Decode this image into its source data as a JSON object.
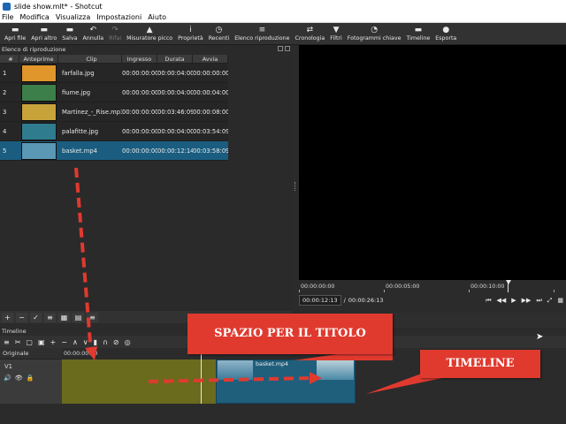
{
  "window": {
    "title": "slide show.mlt* - Shotcut"
  },
  "menu": [
    "File",
    "Modifica",
    "Visualizza",
    "Impostazioni",
    "Aiuto"
  ],
  "toolbar": [
    {
      "label": "Apri file",
      "icon": "folder-open-icon",
      "glyph": "▬"
    },
    {
      "label": "Apri altro",
      "icon": "open-other-icon",
      "glyph": "▬"
    },
    {
      "label": "Salva",
      "icon": "save-icon",
      "glyph": "▬"
    },
    {
      "label": "Annulla",
      "icon": "undo-icon",
      "glyph": "↶"
    },
    {
      "label": "Rifai",
      "icon": "redo-icon",
      "glyph": "↷"
    },
    {
      "label": "Misuratore picco",
      "icon": "peak-meter-icon",
      "glyph": "▲"
    },
    {
      "label": "Proprietà",
      "icon": "info-icon",
      "glyph": "i"
    },
    {
      "label": "Recenti",
      "icon": "clock-icon",
      "glyph": "◷"
    },
    {
      "label": "Elenco riproduzione",
      "icon": "playlist-icon",
      "glyph": "≡"
    },
    {
      "label": "Cronologia",
      "icon": "history-icon",
      "glyph": "⇄"
    },
    {
      "label": "Filtri",
      "icon": "filter-icon",
      "glyph": "▼"
    },
    {
      "label": "Fotogrammi chiave",
      "icon": "keyframes-icon",
      "glyph": "◔"
    },
    {
      "label": "Timeline",
      "icon": "timeline-icon",
      "glyph": "▬"
    },
    {
      "label": "Esporta",
      "icon": "export-icon",
      "glyph": "●"
    }
  ],
  "playlist": {
    "title": "Elenco di riproduzione",
    "columns": [
      "#",
      "Anteprime",
      "Clip",
      "Ingresso",
      "Durata",
      "Avvia"
    ],
    "rows": [
      {
        "num": "1",
        "clip": "farfalla.jpg",
        "in": "00:00:00:00",
        "dur": "00:00:04:00",
        "start": "00:00:00:00",
        "thumb": "#e0962a"
      },
      {
        "num": "2",
        "clip": "fiume.jpg",
        "in": "00:00:00:00",
        "dur": "00:00:04:00",
        "start": "00:00:04:00",
        "thumb": "#3d7f4a"
      },
      {
        "num": "3",
        "clip": "Martinez_-_Rise.mp3",
        "in": "00:00:00:00",
        "dur": "00:03:46:09",
        "start": "00:00:08:00",
        "thumb": "#c8a23b"
      },
      {
        "num": "4",
        "clip": "palafitte.jpg",
        "in": "00:00:00:00",
        "dur": "00:00:04:00",
        "start": "00:03:54:09",
        "thumb": "#2f7c8f"
      },
      {
        "num": "5",
        "clip": "basket.mp4",
        "in": "00:00:00:00",
        "dur": "00:00:12:14",
        "start": "00:03:58:09",
        "thumb": "#5a98b5",
        "selected": true
      }
    ],
    "footer_buttons": [
      {
        "name": "add-icon",
        "glyph": "+"
      },
      {
        "name": "remove-icon",
        "glyph": "−"
      },
      {
        "name": "check-icon",
        "glyph": "✓"
      },
      {
        "name": "list-view-icon",
        "glyph": "≡"
      },
      {
        "name": "grid-view-icon",
        "glyph": "▦"
      },
      {
        "name": "tiles-view-icon",
        "glyph": "▤"
      },
      {
        "name": "menu-icon",
        "glyph": "≡"
      }
    ]
  },
  "viewer": {
    "ruler_ticks": [
      "00:00:00:00",
      "00:00:05:00",
      "00:00:10:00"
    ],
    "current_time": "00:00:12:13",
    "separator": "/",
    "total_time": "00:00:26:13",
    "transport": [
      "⏮",
      "◀◀",
      "▶",
      "▶▶",
      "⏭",
      "⤢",
      "▦"
    ]
  },
  "timeline": {
    "title": "Timeline",
    "track_header": "Originale",
    "ruler_tick": "00:00:00:00",
    "track_name": "V1",
    "track_icons": [
      "🔊",
      "👁",
      "🔒"
    ],
    "clip_label": "basket.mp4",
    "tools": [
      "≡",
      "✂",
      "▢",
      "▣",
      "+",
      "−",
      "∧",
      "∨",
      "▮",
      "∩",
      "⊘",
      "◎"
    ]
  },
  "annotations": {
    "title_callout": "SPAZIO PER IL TITOLO",
    "timeline_callout": "TIMELINE",
    "arrow_color": "#e03a2f"
  },
  "colors": {
    "selection": "#1a5d80",
    "clip_olive": "#6a6b1d",
    "clip_blue": "#1f5f7c"
  }
}
